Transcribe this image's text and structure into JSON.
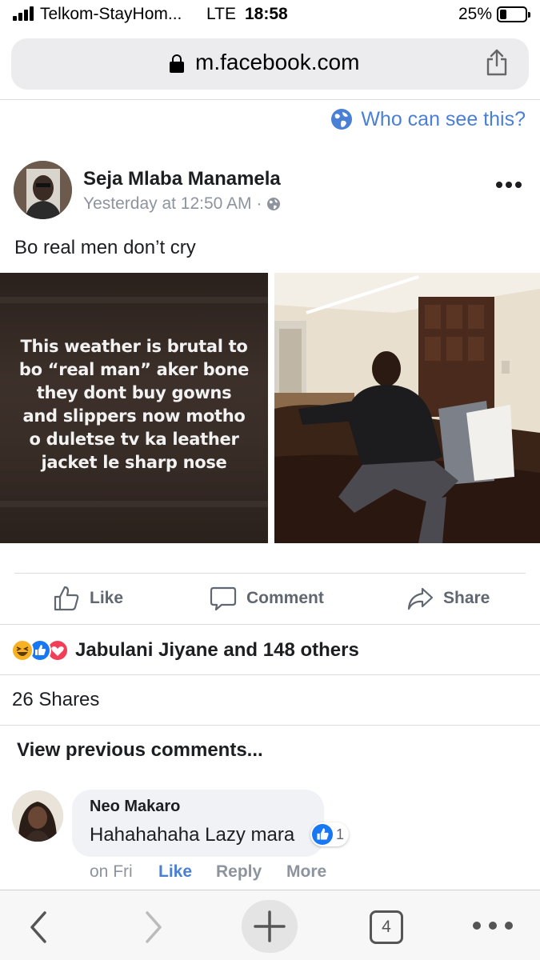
{
  "status_bar": {
    "carrier": "Telkom-StayHom...",
    "network": "LTE",
    "time": "18:58",
    "battery": "25%",
    "battery_level": 0.25
  },
  "browser": {
    "url": "m.facebook.com"
  },
  "audience": {
    "label": "Who can see this?"
  },
  "post": {
    "author": "Seja Mlaba Manamela",
    "timestamp": "Yesterday at 12:50 AM ·",
    "text": "Bo real men don’t cry",
    "meme_lines": [
      "This weather is brutal to",
      "bo “real man” aker bone",
      "they dont buy gowns",
      "and slippers now motho",
      "o duletse tv ka leather",
      "jacket le sharp nose"
    ]
  },
  "actions": {
    "like": "Like",
    "comment": "Comment",
    "share": "Share"
  },
  "reactions": {
    "summary": "Jabulani Jiyane and 148 others",
    "types": [
      "haha",
      "like",
      "love"
    ]
  },
  "shares": "26 Shares",
  "comments": {
    "view_previous": "View previous comments...",
    "items": [
      {
        "author": "Neo Makaro",
        "text": "Hahahahaha Lazy mara",
        "like_count": "1",
        "time": "on Fri",
        "like_label": "Like",
        "reply_label": "Reply",
        "more_label": "More"
      }
    ]
  },
  "toolbar": {
    "tab_count": "4"
  },
  "colors": {
    "link_blue": "#4a7fd6",
    "like_blue": "#1877f2",
    "love_red": "#f33e58",
    "haha_yellow": "#f7b125",
    "muted": "#8d949e"
  }
}
